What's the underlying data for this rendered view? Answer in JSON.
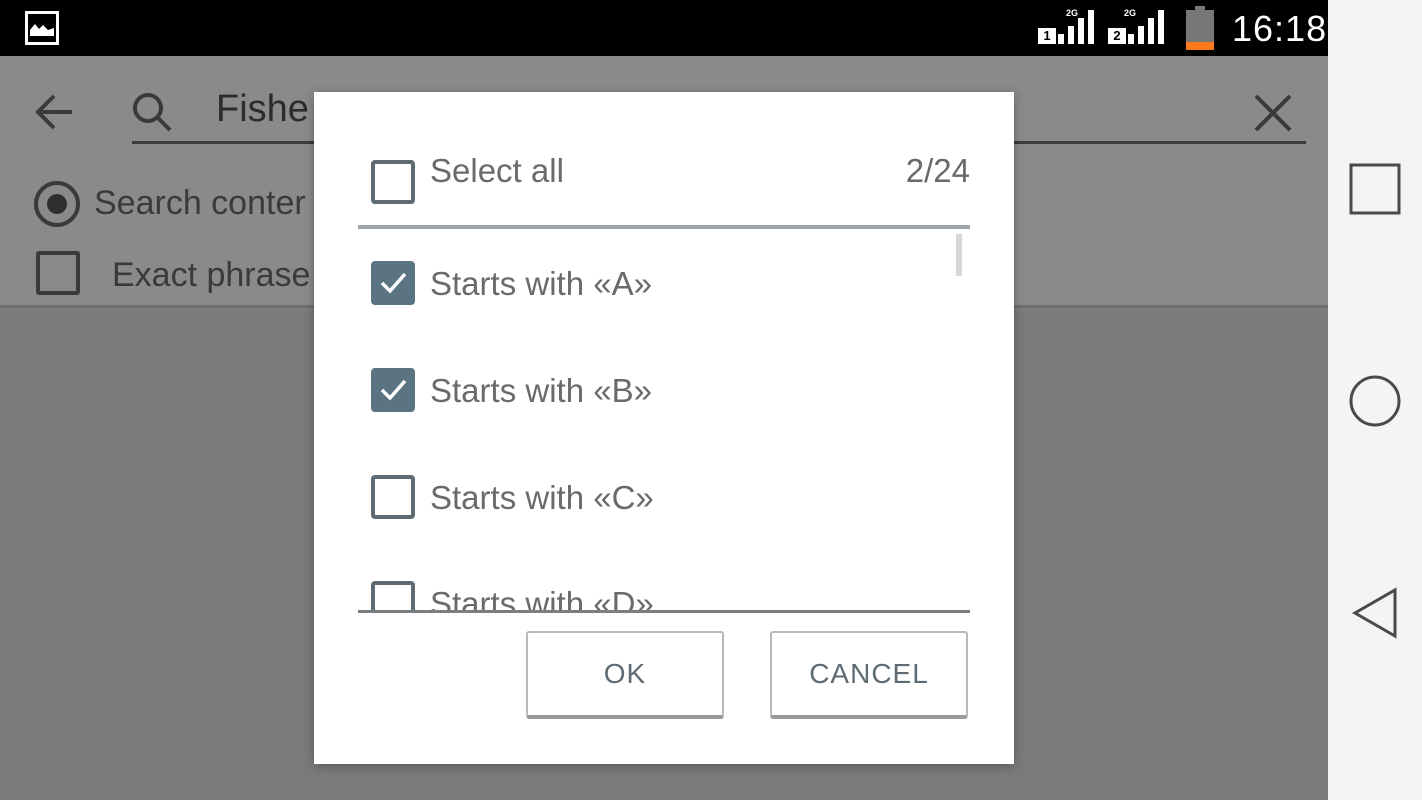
{
  "status_bar": {
    "notification_icon": "gallery-icon",
    "sim1": {
      "generation": "2G",
      "label": "1"
    },
    "sim2": {
      "generation": "2G",
      "label": "2"
    },
    "battery_level_percent": 20,
    "battery_color": "#ff7a1a",
    "time": "16:18"
  },
  "search_bar": {
    "back_icon": "arrow-left-icon",
    "search_icon": "search-icon",
    "value": "Fishe",
    "clear_icon": "close-icon"
  },
  "options": {
    "radio_label": "Search conter",
    "radio_selected": true,
    "exact_phrase_label": "Exact phrase",
    "exact_phrase_checked": false
  },
  "dialog": {
    "select_all_label": "Select all",
    "select_all_checked": false,
    "count": "2/24",
    "items": [
      {
        "label": "Starts with «A»",
        "checked": true
      },
      {
        "label": "Starts with «B»",
        "checked": true
      },
      {
        "label": "Starts with «C»",
        "checked": false
      },
      {
        "label": "Starts with «D»",
        "checked": false
      }
    ],
    "ok_label": "OK",
    "cancel_label": "CANCEL",
    "accent_color": "#5a7482"
  },
  "nav_bar": {
    "recents_icon": "square-icon",
    "home_icon": "circle-icon",
    "back_icon": "triangle-back-icon"
  }
}
